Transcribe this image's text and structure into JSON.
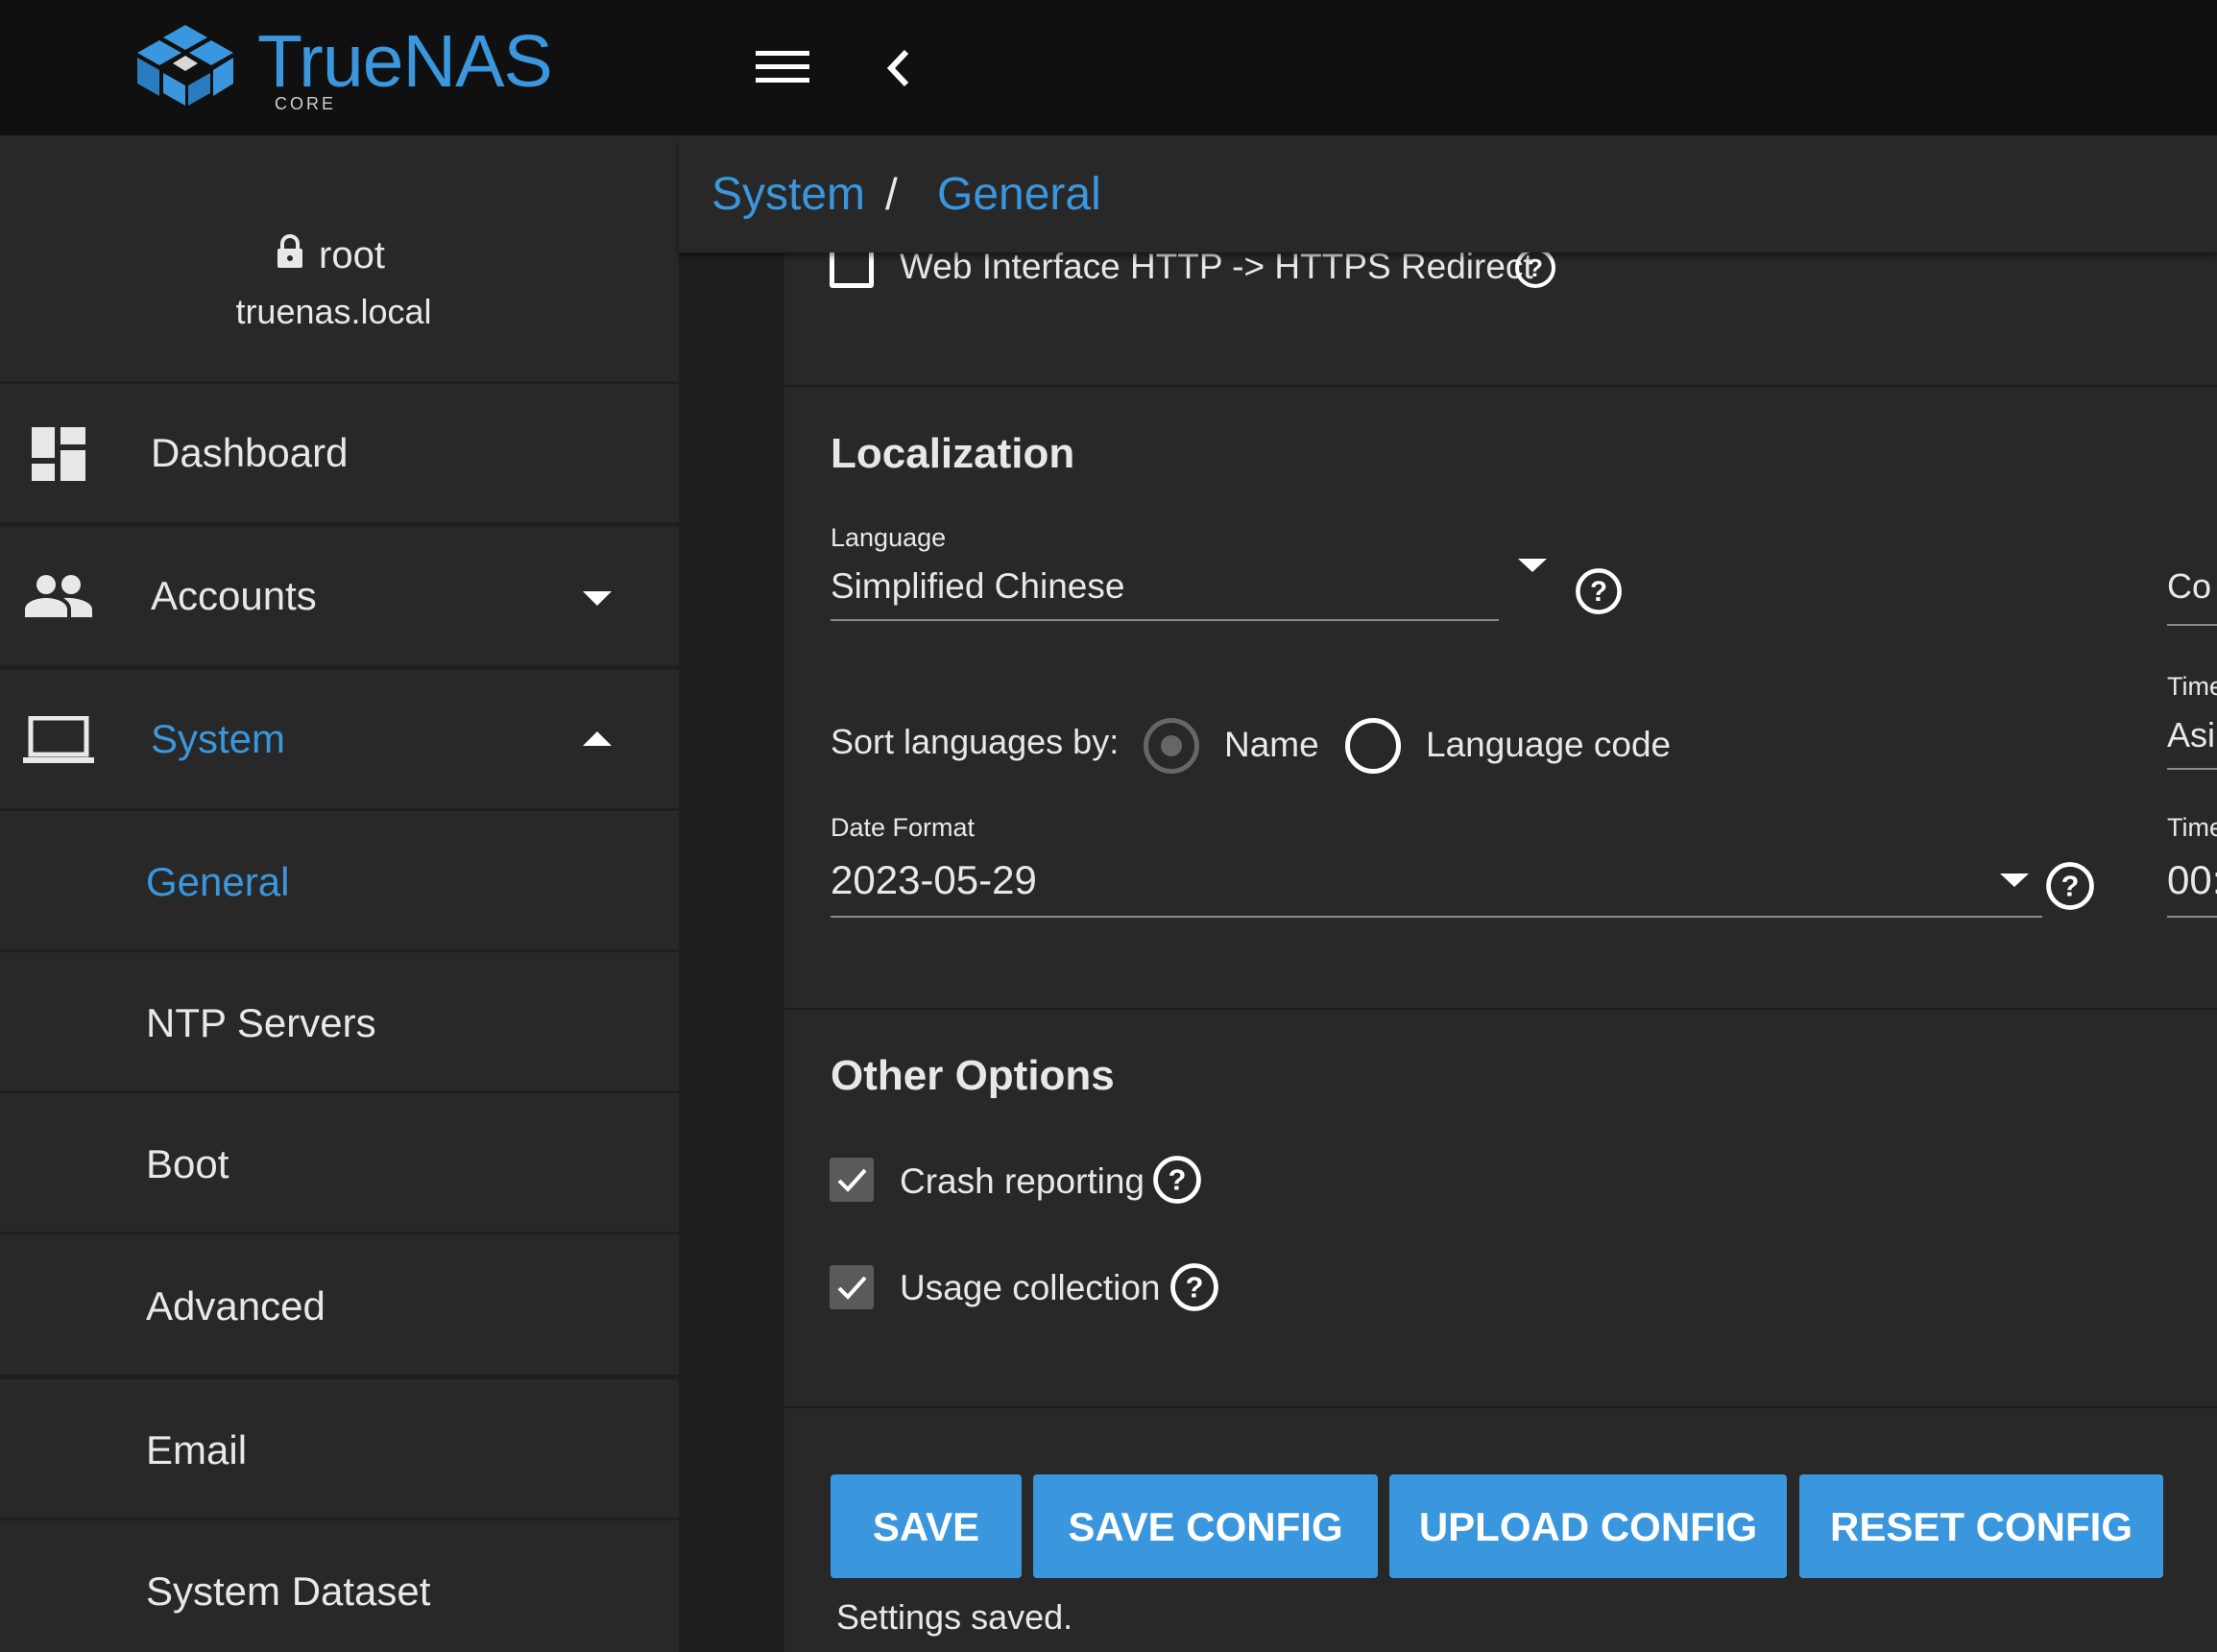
{
  "app": {
    "logo_text": "TrueNAS",
    "logo_sub": "CORE",
    "brand_color": "#3a96dd"
  },
  "user": {
    "name": "root",
    "host": "truenas.local"
  },
  "sidebar": {
    "items": [
      {
        "label": "Dashboard",
        "icon": "dashboard-icon"
      },
      {
        "label": "Accounts",
        "icon": "people-icon",
        "expand": "collapsed"
      },
      {
        "label": "System",
        "icon": "laptop-icon",
        "expand": "expanded",
        "active": true
      }
    ],
    "sub_items": [
      {
        "label": "General",
        "active": true
      },
      {
        "label": "NTP Servers"
      },
      {
        "label": "Boot"
      },
      {
        "label": "Advanced"
      },
      {
        "label": "Email"
      },
      {
        "label": "System Dataset"
      }
    ]
  },
  "breadcrumb": {
    "first": "System",
    "separator": "/",
    "second": "General"
  },
  "gui": {
    "https_redirect_label": "Web Interface HTTP -> HTTPS Redirect",
    "https_redirect_checked": false
  },
  "localization": {
    "title": "Localization",
    "language_label": "Language",
    "language_value": "Simplified Chinese",
    "sort_label": "Sort languages by:",
    "sort_options": [
      "Name",
      "Language code"
    ],
    "sort_selected": "Name",
    "date_format_label": "Date Format",
    "date_format_value": "2023-05-29",
    "right_col": {
      "console_value_fragment": "Co",
      "timezone_label_fragment": "Time",
      "timezone_value_fragment": "Asi",
      "timeformat_label_fragment": "Time",
      "timeformat_value_fragment": "00:"
    }
  },
  "other_options": {
    "title": "Other Options",
    "crash_reporting_label": "Crash reporting",
    "crash_reporting_checked": true,
    "usage_collection_label": "Usage collection",
    "usage_collection_checked": true
  },
  "buttons": {
    "save": "SAVE",
    "save_config": "SAVE CONFIG",
    "upload_config": "UPLOAD CONFIG",
    "reset_config": "RESET CONFIG"
  },
  "status": "Settings saved."
}
